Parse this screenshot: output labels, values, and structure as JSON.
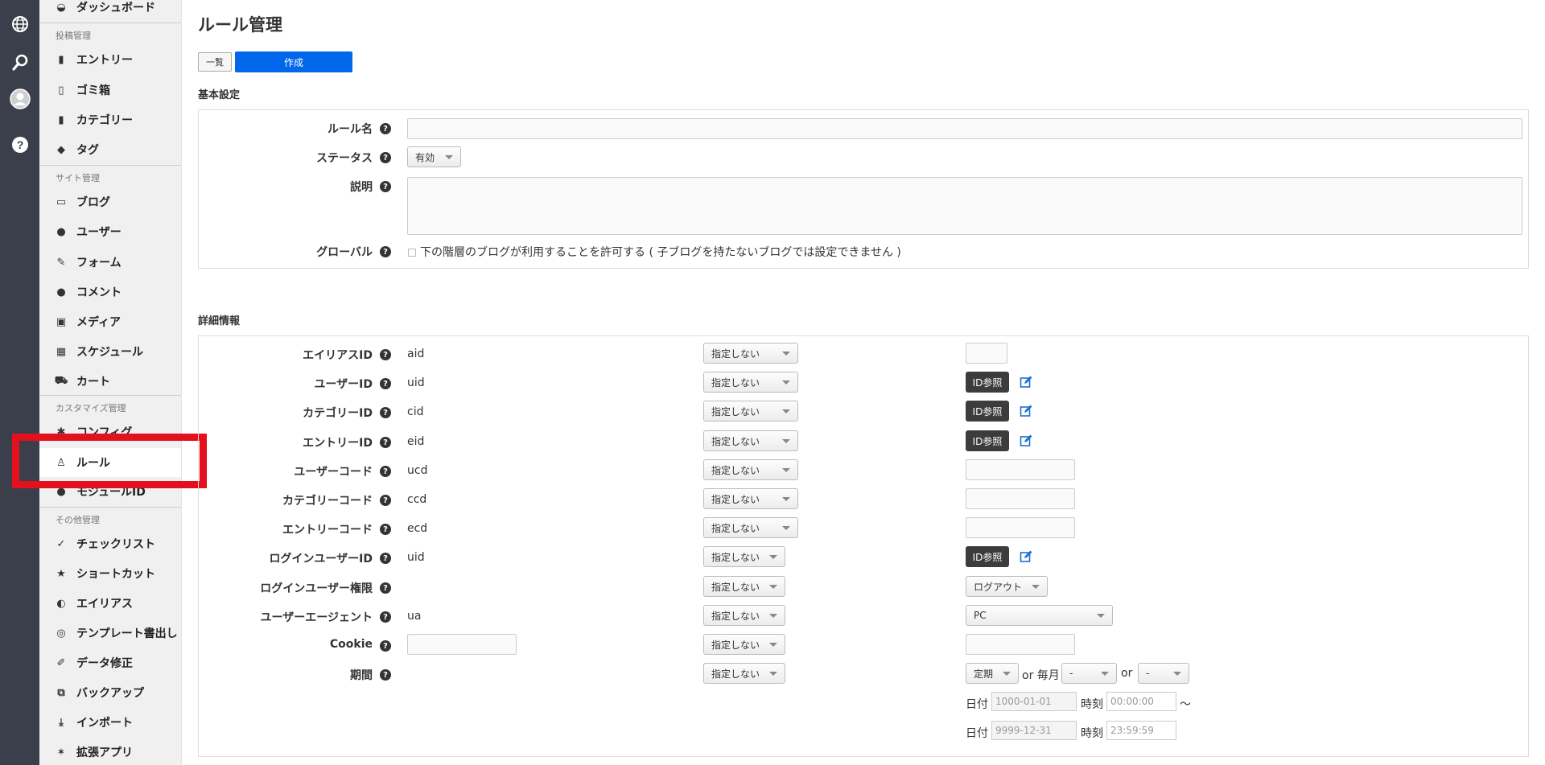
{
  "rail": {
    "icons": [
      "globe-icon",
      "search-icon",
      "avatar",
      "help-icon"
    ]
  },
  "sidebar": {
    "top_item": "ダッシュボード",
    "sections": [
      {
        "heading": "投稿管理",
        "items": [
          "エントリー",
          "ゴミ箱",
          "カテゴリー",
          "タグ"
        ]
      },
      {
        "heading": "サイト管理",
        "items": [
          "ブログ",
          "ユーザー",
          "フォーム",
          "コメント",
          "メディア",
          "スケジュール",
          "カート"
        ]
      },
      {
        "heading": "カスタマイズ管理",
        "items": [
          "コンフィグ",
          "ルール",
          "モジュールID"
        ]
      },
      {
        "heading": "その他管理",
        "items": [
          "チェックリスト",
          "ショートカット",
          "エイリアス",
          "テンプレート書出し",
          "データ修正",
          "バックアップ",
          "インポート",
          "拡張アプリ"
        ]
      }
    ],
    "active_item": "ルール"
  },
  "main": {
    "title": "ルール管理",
    "btn_list": "一覧",
    "btn_create": "作成",
    "basic_section": "基本設定",
    "basic": {
      "rule_name_label": "ルール名",
      "status_label": "ステータス",
      "status_value": "有効",
      "description_label": "説明",
      "global_label": "グローバル",
      "global_checkbox_text": "下の階層のブログが利用することを許可する ( 子ブログを持たないブログでは設定できません )"
    },
    "detail_section": "詳細情報",
    "detail_rows": [
      {
        "label": "エイリアスID",
        "param": "aid",
        "select": "指定しない"
      },
      {
        "label": "ユーザーID",
        "param": "uid",
        "select": "指定しない"
      },
      {
        "label": "カテゴリーID",
        "param": "cid",
        "select": "指定しない"
      },
      {
        "label": "エントリーID",
        "param": "eid",
        "select": "指定しない"
      },
      {
        "label": "ユーザーコード",
        "param": "ucd",
        "select": "指定しない"
      },
      {
        "label": "カテゴリーコード",
        "param": "ccd",
        "select": "指定しない"
      },
      {
        "label": "エントリーコード",
        "param": "ecd",
        "select": "指定しない"
      },
      {
        "label": "ログインユーザーID",
        "param": "uid",
        "select": "指定しない"
      },
      {
        "label": "ログインユーザー権限",
        "param": "",
        "select": "指定しない"
      },
      {
        "label": "ユーザーエージェント",
        "param": "ua",
        "select": "指定しない"
      },
      {
        "label": "Cookie",
        "param": "",
        "select": "指定しない"
      },
      {
        "label": "期間",
        "param": "",
        "select": "指定しない"
      }
    ],
    "id_ref_label": "ID参照",
    "login_auth_value": "ログアウト",
    "ua_value": "PC",
    "period": {
      "type_value": "定期",
      "or1": "or 毎月",
      "month_value": "-",
      "or2": "or",
      "day_value": "-",
      "date_label": "日付",
      "time_label": "時刻",
      "start_date": "1000-01-01",
      "start_time": "00:00:00",
      "tilde": "〜",
      "end_date": "9999-12-31",
      "end_time": "23:59:59"
    }
  }
}
